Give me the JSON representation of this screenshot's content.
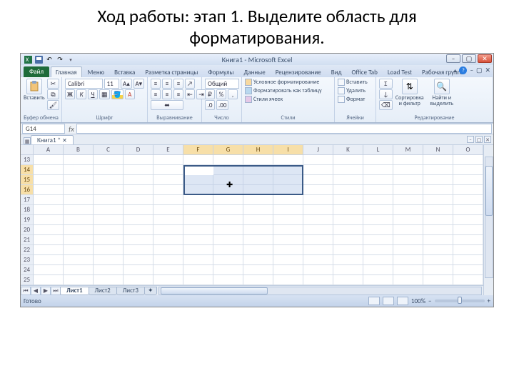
{
  "slide": {
    "title": "Ход работы: этап 1. Выделите область для форматирования."
  },
  "titlebar": {
    "doc": "Книга1",
    "app": "Microsoft Excel"
  },
  "tabs": {
    "file": "Файл",
    "list": [
      "Главная",
      "Меню",
      "Вставка",
      "Разметка страницы",
      "Формулы",
      "Данные",
      "Рецензирование",
      "Вид",
      "Office Tab",
      "Load Test",
      "Рабочая группа"
    ],
    "active": 0
  },
  "ribbon": {
    "clipboard": {
      "label": "Буфер обмена",
      "paste": "Вставить"
    },
    "font": {
      "label": "Шрифт",
      "name": "Calibri",
      "size": "11"
    },
    "align": {
      "label": "Выравнивание"
    },
    "number": {
      "label": "Число",
      "format": "Общий"
    },
    "styles": {
      "label": "Стили",
      "cond": "Условное форматирование",
      "table": "Форматировать как таблицу",
      "cell": "Стили ячеек"
    },
    "cells": {
      "label": "Ячейки",
      "insert": "Вставить",
      "delete": "Удалить",
      "format": "Формат"
    },
    "editing": {
      "label": "Редактирование",
      "sort": "Сортировка и фильтр",
      "find": "Найти и выделить"
    }
  },
  "namebox": "G14",
  "wbtab": "Книга1",
  "columns": [
    "A",
    "B",
    "C",
    "D",
    "E",
    "F",
    "G",
    "H",
    "I",
    "J",
    "K",
    "L",
    "M",
    "N",
    "O"
  ],
  "rows": [
    "13",
    "14",
    "15",
    "16",
    "17",
    "18",
    "19",
    "20",
    "21",
    "22",
    "23",
    "24",
    "25"
  ],
  "sel_cols": [
    "F",
    "G",
    "H",
    "I"
  ],
  "sel_rows": [
    "14",
    "15",
    "16"
  ],
  "sheets": {
    "nav": [
      "⏮",
      "◀",
      "▶",
      "⏭"
    ],
    "list": [
      "Лист1",
      "Лист2",
      "Лист3"
    ],
    "active": 0
  },
  "status": {
    "ready": "Готово",
    "zoom": "100%"
  }
}
